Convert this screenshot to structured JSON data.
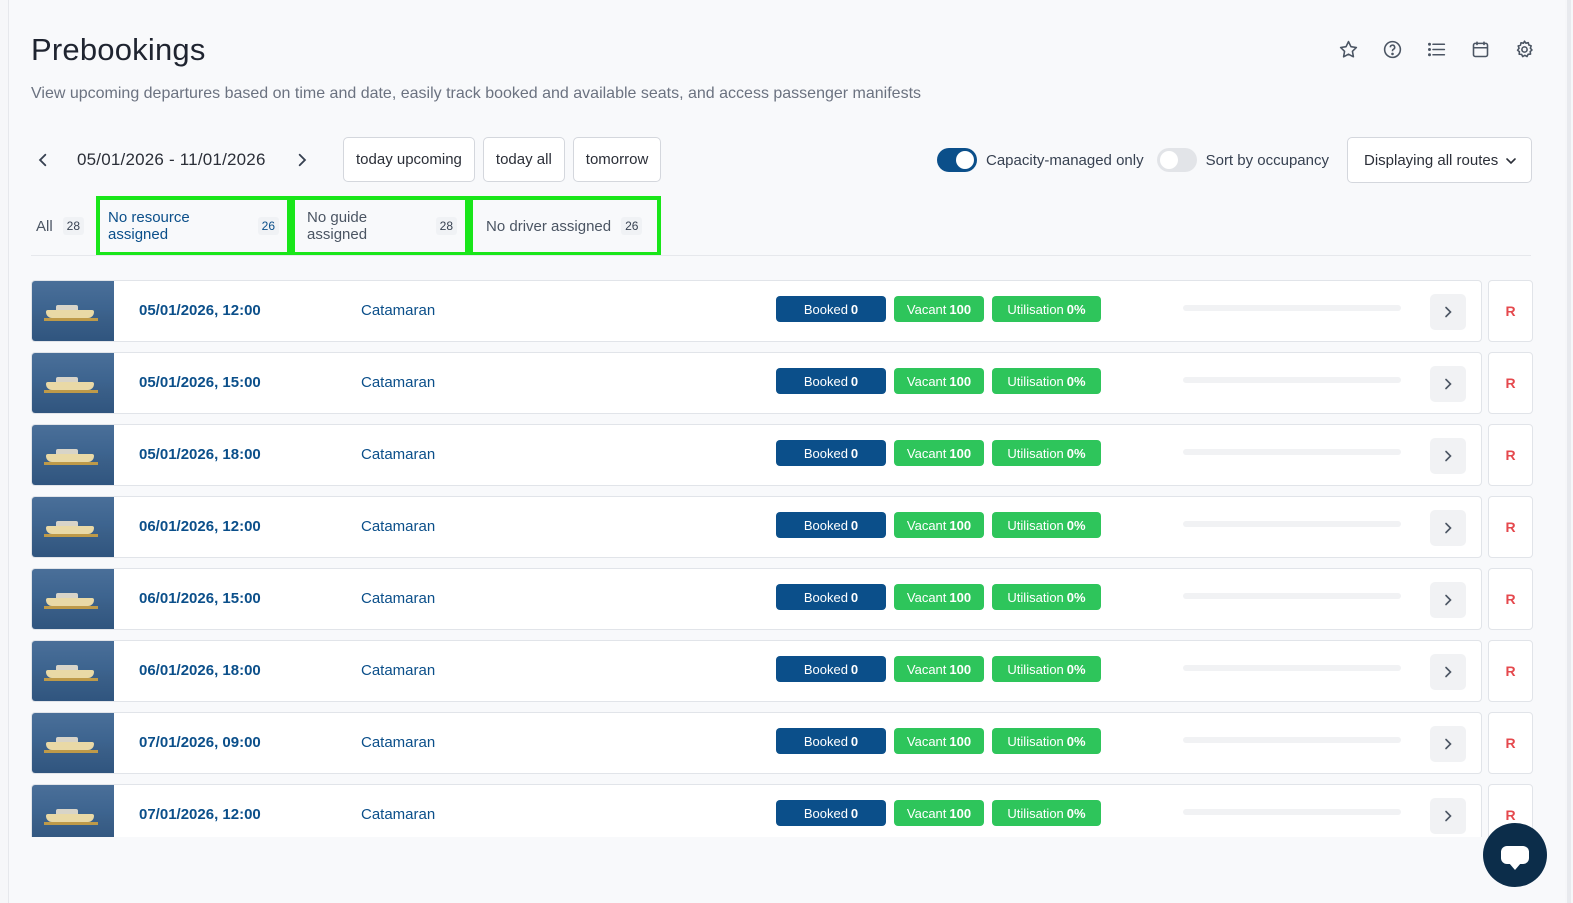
{
  "header": {
    "title": "Prebookings",
    "subtitle": "View upcoming departures based on time and date, easily track booked and available seats, and access passenger manifests",
    "icons": [
      "star-icon",
      "help-icon",
      "list-icon",
      "calendar-icon",
      "gear-icon"
    ]
  },
  "date_nav": {
    "range": "05/01/2026 - 11/01/2026",
    "quick": [
      "today upcoming",
      "today all",
      "tomorrow"
    ]
  },
  "toggles": {
    "capacity_label": "Capacity-managed only",
    "capacity_on": true,
    "sort_label": "Sort by occupancy",
    "sort_on": false
  },
  "routes_dropdown": "Displaying all routes",
  "filter_tabs": [
    {
      "label": "All",
      "count": "28"
    },
    {
      "label": "No resource assigned",
      "count": "26"
    },
    {
      "label": "No guide assigned",
      "count": "28"
    },
    {
      "label": "No driver assigned",
      "count": "26"
    }
  ],
  "rows": [
    {
      "datetime": "05/01/2026, 12:00",
      "product": "Catamaran",
      "booked": "Booked",
      "booked_n": "0",
      "vacant": "Vacant",
      "vacant_n": "100",
      "util": "Utilisation",
      "util_n": "0%",
      "r": "R"
    },
    {
      "datetime": "05/01/2026, 15:00",
      "product": "Catamaran",
      "booked": "Booked",
      "booked_n": "0",
      "vacant": "Vacant",
      "vacant_n": "100",
      "util": "Utilisation",
      "util_n": "0%",
      "r": "R"
    },
    {
      "datetime": "05/01/2026, 18:00",
      "product": "Catamaran",
      "booked": "Booked",
      "booked_n": "0",
      "vacant": "Vacant",
      "vacant_n": "100",
      "util": "Utilisation",
      "util_n": "0%",
      "r": "R"
    },
    {
      "datetime": "06/01/2026, 12:00",
      "product": "Catamaran",
      "booked": "Booked",
      "booked_n": "0",
      "vacant": "Vacant",
      "vacant_n": "100",
      "util": "Utilisation",
      "util_n": "0%",
      "r": "R"
    },
    {
      "datetime": "06/01/2026, 15:00",
      "product": "Catamaran",
      "booked": "Booked",
      "booked_n": "0",
      "vacant": "Vacant",
      "vacant_n": "100",
      "util": "Utilisation",
      "util_n": "0%",
      "r": "R"
    },
    {
      "datetime": "06/01/2026, 18:00",
      "product": "Catamaran",
      "booked": "Booked",
      "booked_n": "0",
      "vacant": "Vacant",
      "vacant_n": "100",
      "util": "Utilisation",
      "util_n": "0%",
      "r": "R"
    },
    {
      "datetime": "07/01/2026, 09:00",
      "product": "Catamaran",
      "booked": "Booked",
      "booked_n": "0",
      "vacant": "Vacant",
      "vacant_n": "100",
      "util": "Utilisation",
      "util_n": "0%",
      "r": "R"
    },
    {
      "datetime": "07/01/2026, 12:00",
      "product": "Catamaran",
      "booked": "Booked",
      "booked_n": "0",
      "vacant": "Vacant",
      "vacant_n": "100",
      "util": "Utilisation",
      "util_n": "0%",
      "r": "R"
    }
  ],
  "colors": {
    "primary": "#0b4f8a",
    "success": "#2ec55b",
    "danger": "#e5484d",
    "highlight": "#19e619"
  }
}
